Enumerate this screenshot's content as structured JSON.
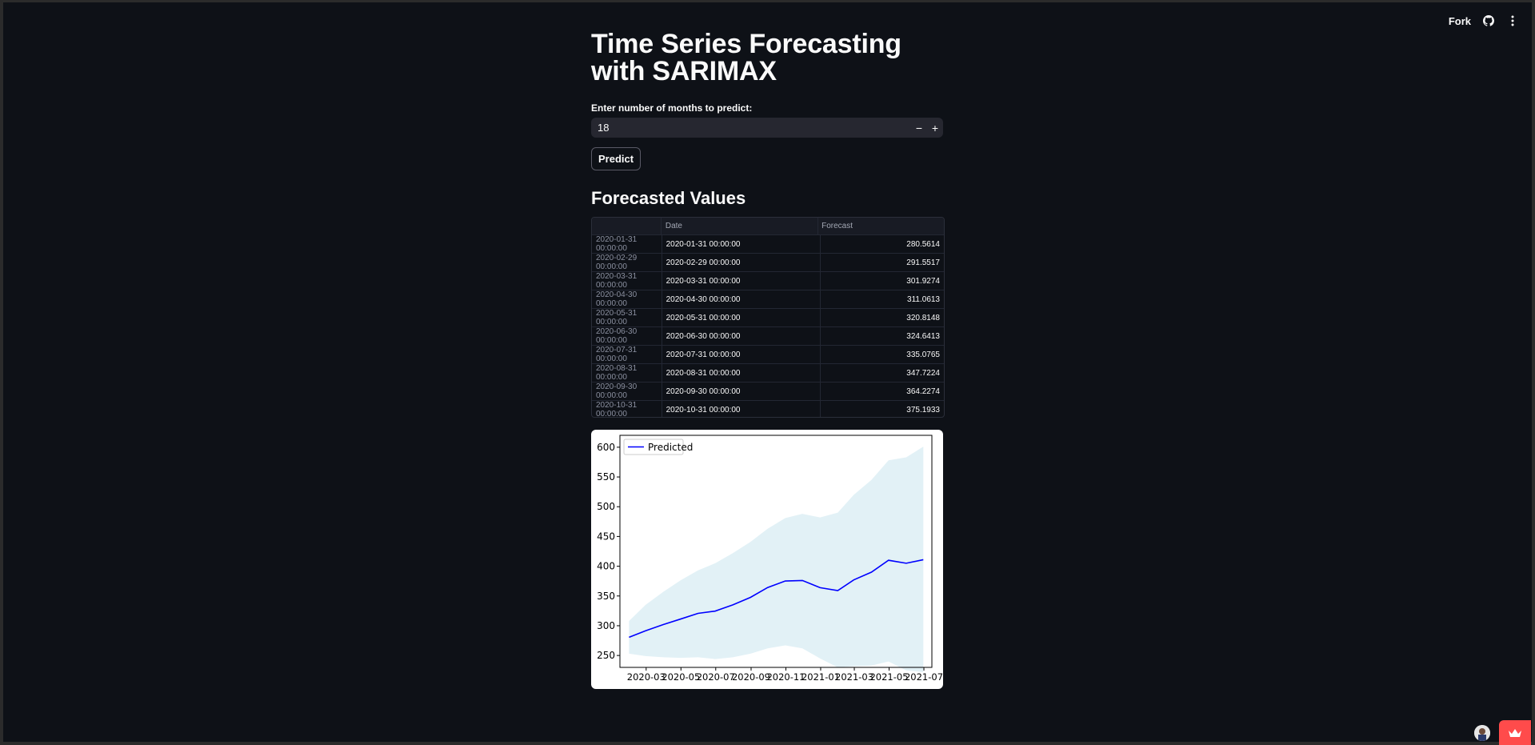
{
  "header": {
    "fork_label": "Fork",
    "github_icon": "github-icon",
    "menu_icon": "kebab-menu-icon"
  },
  "page": {
    "title": "Time Series Forecasting with SARIMAX",
    "input_label": "Enter number of months to predict:",
    "input_value": "18",
    "minus_label": "−",
    "plus_label": "+",
    "predict_label": "Predict",
    "section_title": "Forecasted Values"
  },
  "table": {
    "columns": [
      "",
      "Date",
      "Forecast"
    ],
    "rows": [
      [
        "2020-01-31 00:00:00",
        "2020-01-31 00:00:00",
        "280.5614"
      ],
      [
        "2020-02-29 00:00:00",
        "2020-02-29 00:00:00",
        "291.5517"
      ],
      [
        "2020-03-31 00:00:00",
        "2020-03-31 00:00:00",
        "301.9274"
      ],
      [
        "2020-04-30 00:00:00",
        "2020-04-30 00:00:00",
        "311.0613"
      ],
      [
        "2020-05-31 00:00:00",
        "2020-05-31 00:00:00",
        "320.8148"
      ],
      [
        "2020-06-30 00:00:00",
        "2020-06-30 00:00:00",
        "324.6413"
      ],
      [
        "2020-07-31 00:00:00",
        "2020-07-31 00:00:00",
        "335.0765"
      ],
      [
        "2020-08-31 00:00:00",
        "2020-08-31 00:00:00",
        "347.7224"
      ],
      [
        "2020-09-30 00:00:00",
        "2020-09-30 00:00:00",
        "364.2274"
      ],
      [
        "2020-10-31 00:00:00",
        "2020-10-31 00:00:00",
        "375.1933"
      ]
    ]
  },
  "chart_data": {
    "type": "line",
    "legend": "Predicted",
    "legend_position": "top-left",
    "line_color": "#0000ff",
    "band_color": "#add8e6",
    "x_ticks": [
      "2020-03",
      "2020-05",
      "2020-07",
      "2020-09",
      "2020-11",
      "2021-01",
      "2021-03",
      "2021-05",
      "2021-07"
    ],
    "y_ticks": [
      250,
      300,
      350,
      400,
      450,
      500,
      550,
      600
    ],
    "ylim": [
      230,
      620
    ],
    "x": [
      "2020-01-31",
      "2020-02-29",
      "2020-03-31",
      "2020-04-30",
      "2020-05-31",
      "2020-06-30",
      "2020-07-31",
      "2020-08-31",
      "2020-09-30",
      "2020-10-31",
      "2020-11-30",
      "2020-12-31",
      "2021-01-31",
      "2021-02-28",
      "2021-03-31",
      "2021-04-30",
      "2021-05-31",
      "2021-06-30"
    ],
    "series": [
      {
        "name": "Predicted",
        "values": [
          280.6,
          291.6,
          301.9,
          311.1,
          320.8,
          324.6,
          335.1,
          347.7,
          364.2,
          375.2,
          376,
          364,
          359,
          377,
          390,
          410,
          405,
          411
        ]
      }
    ],
    "lower": [
      253,
      249,
      247,
      246,
      247,
      244,
      247,
      253,
      262,
      267,
      262,
      245,
      230,
      232,
      233,
      240,
      225,
      222
    ],
    "upper": [
      308,
      335,
      357,
      376,
      393,
      405,
      422,
      441,
      463,
      481,
      488,
      482,
      490,
      520,
      545,
      578,
      583,
      601
    ]
  }
}
